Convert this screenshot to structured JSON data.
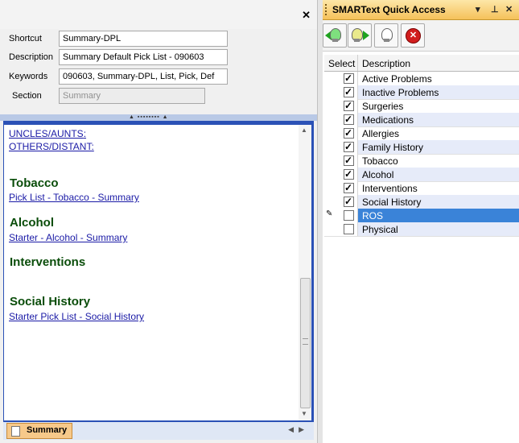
{
  "editor": {
    "fields": {
      "shortcut": {
        "label": "Shortcut",
        "value": "Summary-DPL"
      },
      "description": {
        "label": "Description",
        "value": "Summary Default Pick List - 090603"
      },
      "keywords": {
        "label": "Keywords",
        "value": "090603, Summary-DPL, List, Pick, Def"
      },
      "section": {
        "label": "Section",
        "value": "Summary"
      }
    },
    "document": {
      "links_top": [
        "UNCLES/AUNTS",
        "OTHERS/DISTANT"
      ],
      "sections": [
        {
          "heading": "Tobacco",
          "link": "Pick List - Tobacco - Summary"
        },
        {
          "heading": "Alcohol",
          "link": "Starter - Alcohol - Summary"
        },
        {
          "heading": "Interventions",
          "link": ""
        },
        {
          "heading": "Social History",
          "link": "Starter Pick List - Social History"
        }
      ]
    },
    "tab": {
      "label": "Summary"
    }
  },
  "quick_access": {
    "title": "SMARText Quick Access",
    "columns": {
      "select": "Select",
      "description": "Description"
    },
    "rows": [
      {
        "label": "Active Problems",
        "checked": true
      },
      {
        "label": "Inactive Problems",
        "checked": true
      },
      {
        "label": "Surgeries",
        "checked": true
      },
      {
        "label": "Medications",
        "checked": true
      },
      {
        "label": "Allergies",
        "checked": true
      },
      {
        "label": "Family History",
        "checked": true
      },
      {
        "label": "Tobacco",
        "checked": true
      },
      {
        "label": "Alcohol",
        "checked": true
      },
      {
        "label": "Interventions",
        "checked": true
      },
      {
        "label": "Social History",
        "checked": true
      },
      {
        "label": "ROS",
        "checked": false,
        "editing": true
      },
      {
        "label": "Physical",
        "checked": false
      }
    ]
  },
  "colors": {
    "heading": "#0a4d0a",
    "link": "#1a1aa6",
    "selection": "#3a83d8",
    "alt_row": "#e6ebf9",
    "title_bar": "#f5c15a"
  }
}
